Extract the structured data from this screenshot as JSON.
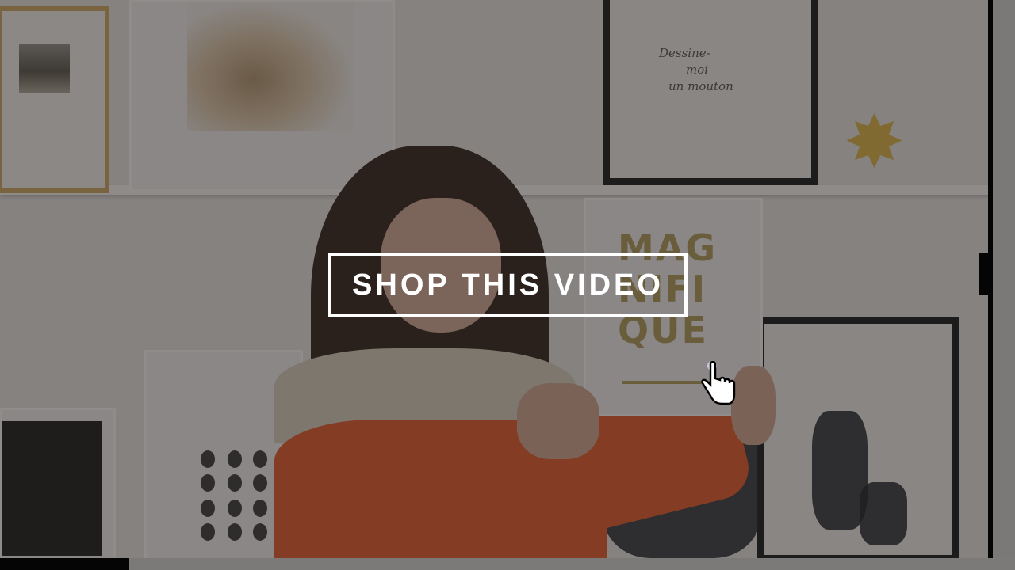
{
  "cta": {
    "label": "SHOP THIS VIDEO"
  },
  "artwork": {
    "script_text": [
      "Dessine-",
      "moi",
      "un mouton"
    ],
    "gold_word": [
      "MAG",
      "NIFI",
      "QUE"
    ]
  },
  "video": {
    "progress": 0.127
  },
  "icons": {
    "cursor": "hand-pointer-icon",
    "ornament": "star-ornament"
  },
  "colors": {
    "cta_border": "#ffffff",
    "cta_text": "#ffffff",
    "overlay": "rgba(0,0,0,0.45)"
  }
}
